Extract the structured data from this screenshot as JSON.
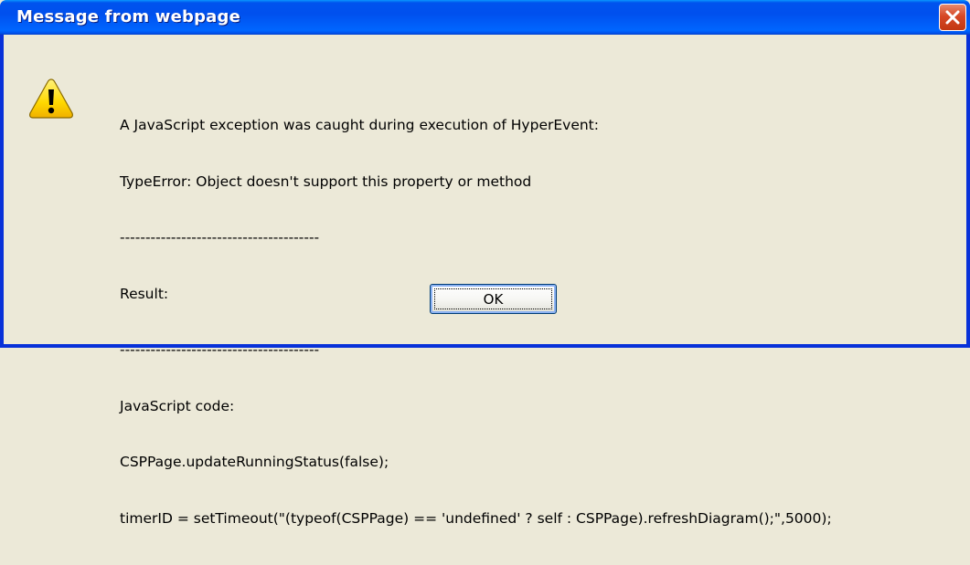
{
  "dialog": {
    "title": "Message from webpage",
    "close_icon": "close-icon",
    "warning_icon": "warning-icon",
    "message_lines": [
      "A JavaScript exception was caught during execution of HyperEvent:",
      "TypeError: Object doesn't support this property or method",
      "---------------------------------------",
      "Result:",
      "---------------------------------------",
      "JavaScript code:",
      "CSPPage.updateRunningStatus(false);",
      "timerID = setTimeout(\"(typeof(CSPPage) == 'undefined' ? self : CSPPage).refreshDiagram();\",5000);"
    ],
    "ok_label": "OK"
  },
  "colors": {
    "titlebar": "#0054e3",
    "close_button": "#d64826",
    "dialog_background": "#ece9d8",
    "warning_yellow": "#ffd800"
  }
}
